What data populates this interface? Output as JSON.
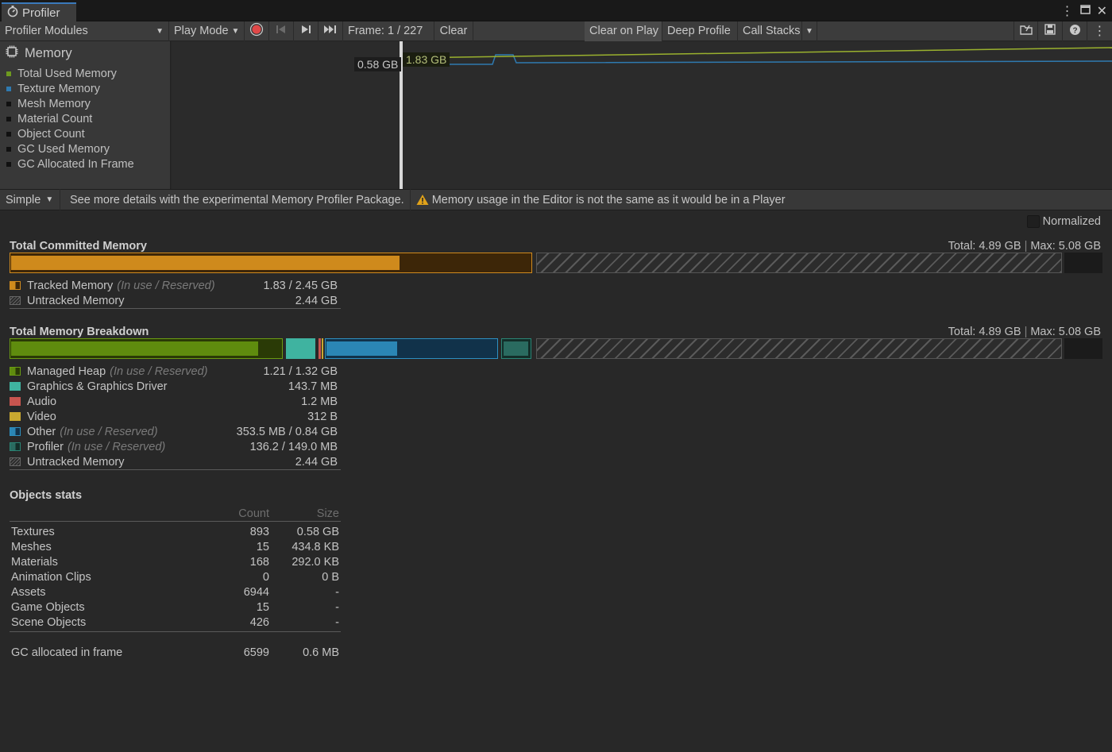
{
  "window": {
    "tab_title": "Profiler"
  },
  "toolbar": {
    "modules_label": "Profiler Modules",
    "play_mode_label": "Play Mode",
    "frame_label": "Frame: 1 / 227",
    "clear_label": "Clear",
    "clear_on_play_label": "Clear on Play",
    "deep_profile_label": "Deep Profile",
    "call_stacks_label": "Call Stacks"
  },
  "chart_legend": {
    "title": "Memory",
    "items": [
      {
        "label": "Total Used Memory",
        "color": "#6e9a1f"
      },
      {
        "label": "Texture Memory",
        "color": "#2f7ab0"
      },
      {
        "label": "Mesh Memory",
        "color": "#111111"
      },
      {
        "label": "Material Count",
        "color": "#111111"
      },
      {
        "label": "Object Count",
        "color": "#111111"
      },
      {
        "label": "GC Used Memory",
        "color": "#111111"
      },
      {
        "label": "GC Allocated In Frame",
        "color": "#111111"
      }
    ]
  },
  "chart": {
    "label_texture": "0.58 GB",
    "label_total": "1.83 GB"
  },
  "subbar": {
    "mode_label": "Simple",
    "info_text": "See more details with the experimental Memory Profiler Package.",
    "warning_text": "Memory usage in the Editor is not the same as it would be in a Player"
  },
  "details": {
    "normalized_label": "Normalized",
    "committed": {
      "title": "Total Committed Memory",
      "total": "Total: 4.89 GB",
      "max": "Max: 5.08 GB",
      "rows": [
        {
          "name": "Tracked Memory",
          "sub": "(In use / Reserved)",
          "value": "1.83 / 2.45 GB"
        },
        {
          "name": "Untracked Memory",
          "sub": "",
          "value": "2.44 GB"
        }
      ]
    },
    "breakdown": {
      "title": "Total Memory Breakdown",
      "total": "Total: 4.89 GB",
      "max": "Max: 5.08 GB",
      "rows": [
        {
          "name": "Managed Heap",
          "sub": "(In use / Reserved)",
          "value": "1.21 / 1.32 GB"
        },
        {
          "name": "Graphics & Graphics Driver",
          "sub": "",
          "value": "143.7 MB"
        },
        {
          "name": "Audio",
          "sub": "",
          "value": "1.2 MB"
        },
        {
          "name": "Video",
          "sub": "",
          "value": "312 B"
        },
        {
          "name": "Other",
          "sub": "(In use / Reserved)",
          "value": "353.5 MB / 0.84 GB"
        },
        {
          "name": "Profiler",
          "sub": "(In use / Reserved)",
          "value": "136.2 / 149.0 MB"
        },
        {
          "name": "Untracked Memory",
          "sub": "",
          "value": "2.44 GB"
        }
      ]
    },
    "objects": {
      "title": "Objects stats",
      "col_count": "Count",
      "col_size": "Size",
      "rows": [
        {
          "name": "Textures",
          "count": "893",
          "size": "0.58 GB"
        },
        {
          "name": "Meshes",
          "count": "15",
          "size": "434.8 KB"
        },
        {
          "name": "Materials",
          "count": "168",
          "size": "292.0 KB"
        },
        {
          "name": "Animation Clips",
          "count": "0",
          "size": "0 B"
        },
        {
          "name": "Assets",
          "count": "6944",
          "size": "-"
        },
        {
          "name": "Game Objects",
          "count": "15",
          "size": "-"
        },
        {
          "name": "Scene Objects",
          "count": "426",
          "size": "-"
        }
      ],
      "gc": {
        "name": "GC allocated in frame",
        "count": "6599",
        "size": "0.6 MB"
      }
    }
  }
}
